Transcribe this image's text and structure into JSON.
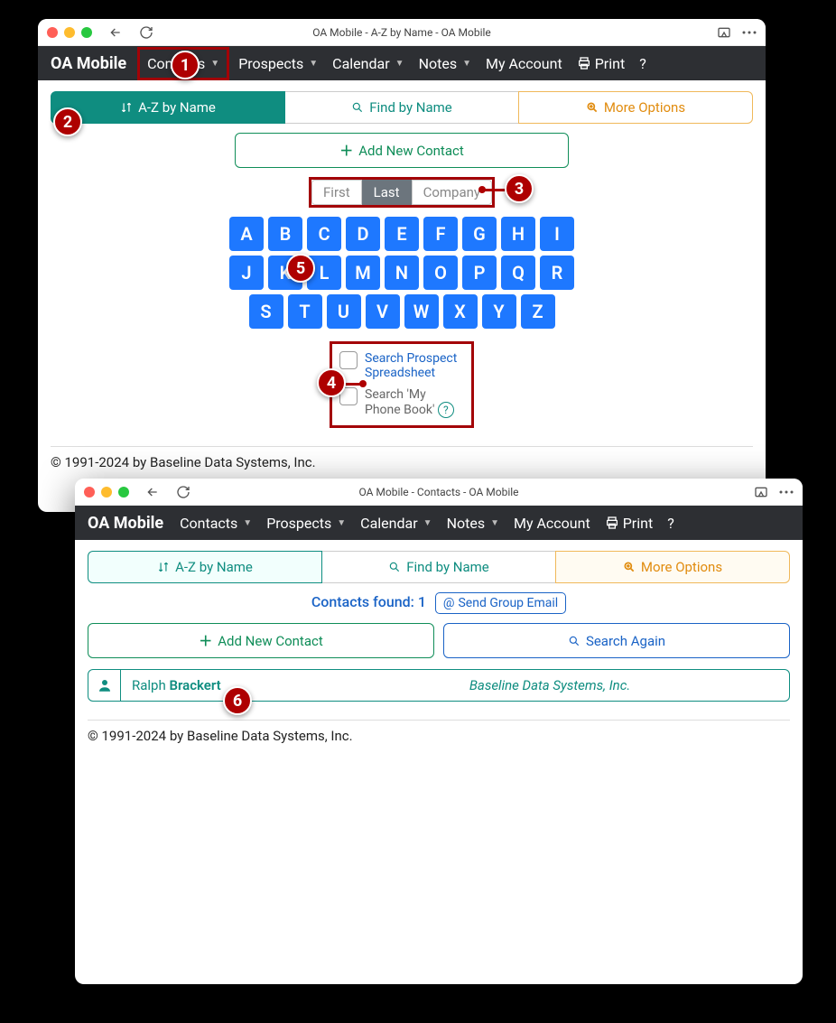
{
  "window1": {
    "title": "OA Mobile - A-Z by Name - OA Mobile",
    "brand": "OA Mobile",
    "nav": {
      "contacts": "Contacts",
      "prospects": "Prospects",
      "calendar": "Calendar",
      "notes": "Notes",
      "account": "My Account",
      "print": "Print",
      "help": "?"
    },
    "tabs": {
      "az": "A-Z by Name",
      "find": "Find by Name",
      "more": "More Options"
    },
    "add": "Add New Contact",
    "sort": {
      "first": "First",
      "last": "Last",
      "company": "Company"
    },
    "letters_row1": [
      "A",
      "B",
      "C",
      "D",
      "E",
      "F",
      "G",
      "H",
      "I"
    ],
    "letters_row2": [
      "J",
      "K",
      "L",
      "M",
      "N",
      "O",
      "P",
      "Q",
      "R"
    ],
    "letters_row3": [
      "S",
      "T",
      "U",
      "V",
      "W",
      "X",
      "Y",
      "Z"
    ],
    "check1": "Search Prospect Spreadsheet",
    "check2a": "Search 'My Phone Book'",
    "check2help": "?",
    "footer": "© 1991-2024 by Baseline Data Systems, Inc."
  },
  "window2": {
    "title": "OA Mobile - Contacts - OA Mobile",
    "brand": "OA Mobile",
    "nav": {
      "contacts": "Contacts",
      "prospects": "Prospects",
      "calendar": "Calendar",
      "notes": "Notes",
      "account": "My Account",
      "print": "Print",
      "help": "?"
    },
    "tabs": {
      "az": "A-Z by Name",
      "find": "Find by Name",
      "more": "More Options"
    },
    "found_label": "Contacts found: 1",
    "send_group": "Send Group Email",
    "add": "Add New Contact",
    "search_again": "Search Again",
    "contact": {
      "first": "Ralph",
      "last": "Brackert",
      "company": "Baseline Data Systems, Inc."
    },
    "footer": "© 1991-2024 by Baseline Data Systems, Inc."
  },
  "callouts": {
    "1": "1",
    "2": "2",
    "3": "3",
    "4": "4",
    "5": "5",
    "6": "6"
  }
}
